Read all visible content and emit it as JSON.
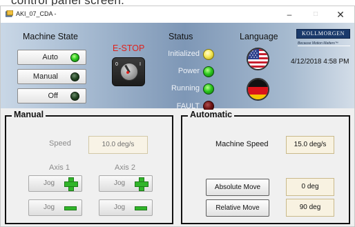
{
  "window": {
    "title": "AKI_07_CDA -",
    "minimize": "–",
    "maximize": "□",
    "close": "✕"
  },
  "top_caption": "control panel screen.",
  "machine_state": {
    "title": "Machine State",
    "buttons": [
      {
        "label": "Auto",
        "indicator": "green"
      },
      {
        "label": "Manual",
        "indicator": "dark"
      },
      {
        "label": "Off",
        "indicator": "dark"
      }
    ]
  },
  "estop": {
    "label": "E-STOP",
    "switch_off": "0",
    "switch_on": "I"
  },
  "status": {
    "title": "Status",
    "items": [
      {
        "label": "Initialized",
        "color": "yellow"
      },
      {
        "label": "Power",
        "color": "green"
      },
      {
        "label": "Running",
        "color": "green"
      },
      {
        "label": "FAULT",
        "color": "dark-red"
      }
    ]
  },
  "language": {
    "title": "Language",
    "options": [
      {
        "icon": "us-flag-icon"
      },
      {
        "icon": "germany-flag-icon"
      }
    ]
  },
  "brand": {
    "name": "KOLLMORGEN",
    "tagline": "Because Motion Matters™"
  },
  "datetime": "4/12/2018 4:58 PM",
  "manual": {
    "title": "Manual",
    "speed_label": "Speed",
    "speed_value": "10.0 deg/s",
    "axis1_label": "Axis 1",
    "axis2_label": "Axis 2",
    "jog_label": "Jog"
  },
  "automatic": {
    "title": "Automatic",
    "speed_label": "Machine Speed",
    "speed_value": "15.0 deg/s",
    "absolute_move_label": "Absolute Move",
    "absolute_move_value": "0 deg",
    "relative_move_label": "Relative Move",
    "relative_move_value": "90 deg"
  },
  "colors": {
    "estop_red": "#e0201b",
    "led_green": "#2cc91e",
    "led_yellow": "#f6e95a",
    "jog_green": "#31b52a",
    "field_bg": "#f8f2e1",
    "header_blue": "#7e97b6"
  }
}
